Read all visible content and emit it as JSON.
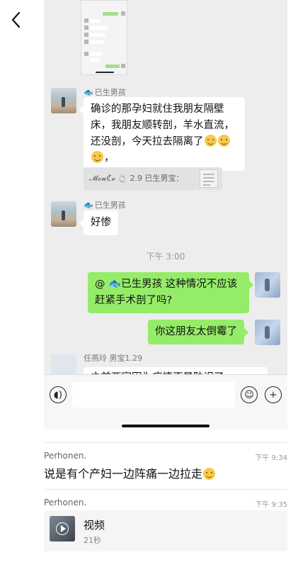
{
  "nav": {
    "back_icon": "chevron-left-icon",
    "more_icon": "more-dots-icon"
  },
  "chat": {
    "messages": [
      {
        "sender": "已生男孩",
        "sender_icon": "fish-icon",
        "text": "确诊的那孕妇就住我朋友隔壁床，我朋友顺转剖，羊水直流，还没剖，今天拉去隔离了"
      },
      {
        "quote": "𝓜𝓸𝓾ℭ̃𝓮 💍 2.9 已生男宝："
      },
      {
        "sender": "已生男孩",
        "sender_icon": "fish-icon",
        "text": "好惨"
      },
      {
        "timestamp": "下午 3:00"
      },
      {
        "outgoing": true,
        "text": "@ 🐟已生男孩 这种情况不应该赶紧手术剖了吗?"
      },
      {
        "outgoing": true,
        "text": "你这朋友太倒霉了"
      },
      {
        "sender": "任燕玲 男宝1.29",
        "text_partial": "之前两家因为疫情不是耽误了一"
      }
    ],
    "input": {
      "voice_icon": "voice-icon",
      "emoji_icon": "emoji-icon",
      "add_icon": "plus-icon"
    }
  },
  "comments": [
    {
      "author": "Perhonen.",
      "time": "下午 9:34",
      "text": "说是有个产妇一边阵痛一边拉走"
    },
    {
      "author": "Perhonen.",
      "time": "下午 9:35",
      "video": {
        "title": "视频",
        "duration": "21秒",
        "icon": "play-icon"
      }
    }
  ],
  "colors": {
    "bubble_out": "#95ec69",
    "chat_bg": "#ededed"
  }
}
